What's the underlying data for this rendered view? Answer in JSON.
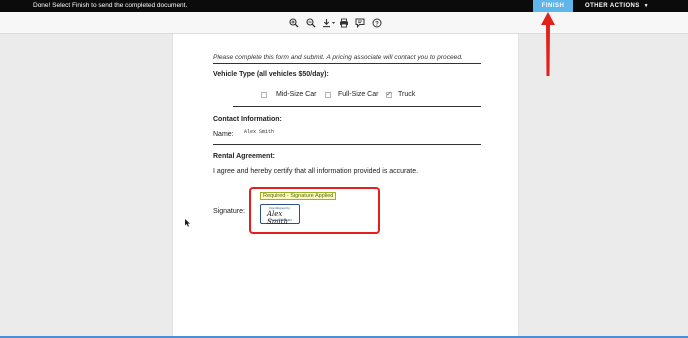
{
  "topbar": {
    "message": "Done! Select Finish to send the completed document.",
    "finish_label": "FINISH",
    "other_actions_label": "OTHER ACTIONS",
    "accent_color": "#5eb6ea"
  },
  "toolbar": {
    "icons": [
      "zoom-in-icon",
      "zoom-out-icon",
      "download-icon",
      "print-icon",
      "comment-icon",
      "help-icon"
    ]
  },
  "document": {
    "intro": "Please complete this form and submit. A pricing associate will contact you to proceed.",
    "vehicle_heading": "Vehicle Type (all vehicles $50/day):",
    "options": [
      {
        "label": "Mid-Size Car",
        "checked": false
      },
      {
        "label": "Full-Size Car",
        "checked": false
      },
      {
        "label": "Truck",
        "checked": true
      }
    ],
    "contact_heading": "Contact Information:",
    "name_label": "Name:",
    "name_value": "Alex Smith",
    "rental_heading": "Rental Agreement:",
    "agreement_text": "I agree and hereby certify that all information provided is accurate.",
    "signature_label": "Signature:",
    "signature_badge": "Required - Signature Applied",
    "signature_stamp_top": "DocuSigned by:",
    "signature_name": "Alex Smith",
    "signature_id": "C7D7F3D8EA5B4E4"
  },
  "annotation": {
    "highlight_color": "#e3201b"
  }
}
